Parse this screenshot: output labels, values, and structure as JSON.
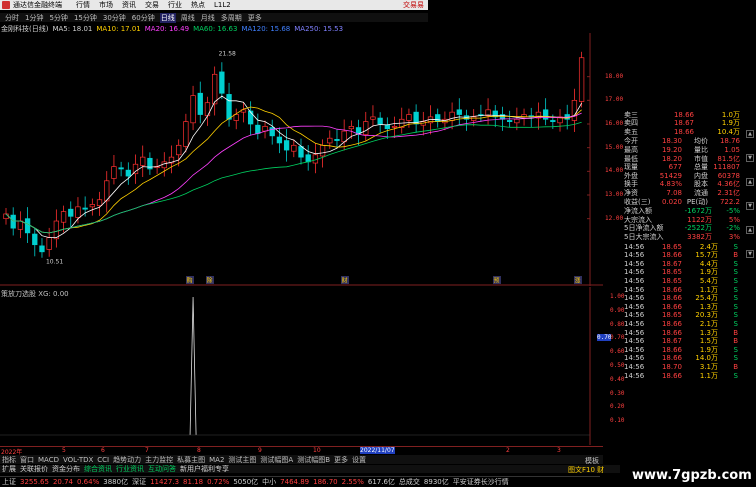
{
  "menubar": {
    "brand": "通达信金融终端",
    "items": [
      "行情",
      "市场",
      "资讯",
      "交易",
      "行业",
      "热点",
      "L1L2"
    ],
    "trade": "交易易"
  },
  "periods": [
    "分时",
    "1分钟",
    "5分钟",
    "15分钟",
    "30分钟",
    "60分钟",
    "日线",
    "周线",
    "月线",
    "多周期",
    "更多"
  ],
  "active_period": "日线",
  "ma_bar": {
    "stock": "金刚科技(日线)",
    "ma5": "MA5: 18.01",
    "ma10": "MA10: 17.01",
    "ma20": "MA20: 16.49",
    "ma60": "MA60: 16.63",
    "ma120": "MA120: 15.68",
    "ma250": "MA250: 15.53"
  },
  "price_axis": [
    "18.00",
    "17.00",
    "16.00",
    "15.00",
    "14.00",
    "13.00",
    "12.00"
  ],
  "price_marks": {
    "high": "21.58",
    "low": "10.51"
  },
  "indicator": {
    "title": "策放刀选股 XG: 0.00",
    "axis": [
      "1.00",
      "0.90",
      "0.80",
      "0.70",
      "0.60",
      "0.50",
      "0.40",
      "0.30",
      "0.20",
      "0.10"
    ],
    "current": "0.70"
  },
  "event_markers": [
    "购",
    "除",
    "财",
    "预",
    "涨"
  ],
  "chart_data": {
    "type": "line",
    "title": "",
    "xlabel": "",
    "ylabel": "",
    "ylim": [
      10,
      19
    ],
    "candles_close": [
      12.2,
      11.6,
      11.9,
      11.4,
      10.9,
      10.6,
      11.2,
      11.9,
      12.3,
      12.1,
      12.5,
      12.4,
      12.6,
      12.8,
      13.6,
      14.2,
      14.1,
      13.8,
      14.3,
      14.6,
      14.1,
      14.2,
      14.4,
      14.6,
      15.1,
      16.1,
      17.2,
      16.4,
      16.9,
      18.1,
      17.3,
      16.2,
      16.4,
      16.6,
      16.0,
      15.6,
      15.9,
      15.5,
      15.2,
      14.9,
      15.1,
      14.6,
      14.4,
      14.7,
      15.1,
      15.4,
      15.3,
      15.7,
      15.9,
      15.6,
      16.1,
      16.3,
      16.0,
      15.8,
      15.9,
      16.2,
      16.4,
      16.0,
      16.1,
      16.3,
      16.1,
      16.2,
      16.5,
      16.4,
      16.2,
      16.3,
      16.4,
      16.6,
      16.3,
      16.2,
      16.1,
      16.2,
      16.4,
      16.3,
      16.5,
      16.2,
      16.1,
      16.3,
      16.2,
      17.0,
      18.8
    ],
    "indicator_spike_index": 26,
    "date_ticks": [
      "2022年",
      "5",
      "6",
      "7",
      "8",
      "9",
      "10",
      "2022/11/07",
      "2",
      "3"
    ]
  },
  "quote": {
    "ask": [
      {
        "label": "卖三",
        "price": "18.66",
        "vol": "1.0万"
      },
      {
        "label": "卖四",
        "price": "18.67",
        "vol": "1.9万"
      },
      {
        "label": "卖五",
        "price": "18.66",
        "vol": "10.4万"
      }
    ],
    "fields": [
      {
        "l1": "今开",
        "v1": "18.30",
        "l2": "均价",
        "v2": "18.76"
      },
      {
        "l1": "最高",
        "v1": "19.20",
        "l2": "量比",
        "v2": "1.05"
      },
      {
        "l1": "最低",
        "v1": "18.20",
        "l2": "市值",
        "v2": "81.5亿"
      },
      {
        "l1": "现量",
        "v1": "677",
        "l2": "总量",
        "v2": "111807"
      },
      {
        "l1": "外盘",
        "v1": "51429",
        "l2": "内盘",
        "v2": "60378"
      },
      {
        "l1": "换手",
        "v1": "4.83%",
        "l2": "股本",
        "v2": "4.36亿"
      },
      {
        "l1": "净资",
        "v1": "7.08",
        "l2": "流通",
        "v2": "2.31亿"
      },
      {
        "l1": "收益(三)",
        "v1": "0.020",
        "l2": "PE(动)",
        "v2": "722.2"
      }
    ],
    "flows": [
      {
        "label": "净流入额",
        "val": "-1672万",
        "pct": "-5%"
      },
      {
        "label": "大宗流入",
        "val": "1122万",
        "pct": "5%"
      },
      {
        "label": "5日净流入额",
        "val": "-2522万",
        "pct": "-2%"
      },
      {
        "label": "5日大宗流入",
        "val": "3382万",
        "pct": "3%"
      }
    ],
    "ticks": [
      {
        "t": "14:56",
        "p": "18.65",
        "v": "2.4万",
        "d": "S"
      },
      {
        "t": "14:56",
        "p": "18.66",
        "v": "15.7万",
        "d": "B"
      },
      {
        "t": "14:56",
        "p": "18.67",
        "v": "4.4万",
        "d": "S"
      },
      {
        "t": "14:56",
        "p": "18.65",
        "v": "1.9万",
        "d": "S"
      },
      {
        "t": "14:56",
        "p": "18.65",
        "v": "5.4万",
        "d": "S"
      },
      {
        "t": "14:56",
        "p": "18.66",
        "v": "1.1万",
        "d": "S"
      },
      {
        "t": "14:56",
        "p": "18.66",
        "v": "25.4万",
        "d": "S"
      },
      {
        "t": "14:56",
        "p": "18.66",
        "v": "1.3万",
        "d": "S"
      },
      {
        "t": "14:56",
        "p": "18.65",
        "v": "20.3万",
        "d": "S"
      },
      {
        "t": "14:56",
        "p": "18.66",
        "v": "2.1万",
        "d": "S"
      },
      {
        "t": "14:56",
        "p": "18.66",
        "v": "1.3万",
        "d": "B"
      },
      {
        "t": "14:56",
        "p": "18.67",
        "v": "1.5万",
        "d": "B"
      },
      {
        "t": "14:56",
        "p": "18.66",
        "v": "1.9万",
        "d": "S"
      },
      {
        "t": "14:56",
        "p": "18.66",
        "v": "14.0万",
        "d": "S"
      },
      {
        "t": "14:56",
        "p": "18.70",
        "v": "3.1万",
        "d": "B"
      },
      {
        "t": "14:56",
        "p": "18.66",
        "v": "1.1万",
        "d": "S"
      }
    ]
  },
  "navbar": [
    "指标",
    "窗口",
    "MACD",
    "VOL-TDX",
    "CCI",
    "趋势动力",
    "主力监控",
    "私募主图",
    "MA2",
    "测试主图",
    "测试幅图A",
    "测试幅图B",
    "更多",
    "设置"
  ],
  "mode_label": "模板",
  "tabbar": [
    "扩展",
    "关联报价",
    "资金分布",
    "综合资讯",
    "行业资讯",
    "互动问答",
    "新用户福利专享"
  ],
  "small_right": "图文F10 财",
  "status": {
    "sh_label": "上证",
    "sh_val": "3255.65",
    "sh_chg": "20.74",
    "sh_pct": "0.64%",
    "sh_amt": "3880亿",
    "sz_label": "深证",
    "sz_val": "11427.3",
    "sz_chg": "81.18",
    "sz_pct": "0.72%",
    "sz_amt": "5050亿",
    "zx_label": "中小",
    "zx_val": "7464.89",
    "zx_chg": "186.70",
    "zx_pct": "2.55%",
    "zx_amt": "617.6亿",
    "zs_label": "总成交",
    "zs_amt": "8930亿",
    "broker": "平安证券长沙行情"
  },
  "watermark": "www.7gpzb.com"
}
